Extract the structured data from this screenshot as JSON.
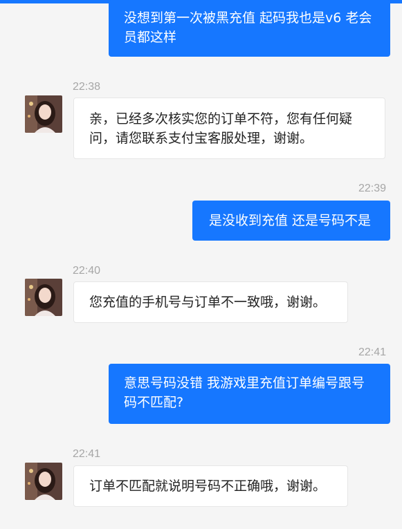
{
  "colors": {
    "accent": "#1677ff",
    "background": "#f5f5f5",
    "incoming_bubble": "#ffffff",
    "timestamp": "#a6a6a6"
  },
  "messages": [
    {
      "direction": "out",
      "time": "",
      "text": "没想到第一次被黑充值 起码我也是v6 老会员都这样"
    },
    {
      "direction": "in",
      "time": "22:38",
      "avatar_icon": "agent-avatar",
      "text": "亲，已经多次核实您的订单不符，您有任何疑问，请您联系支付宝客服处理，谢谢。"
    },
    {
      "direction": "out",
      "time": "22:39",
      "text": "是没收到充值 还是号码不是"
    },
    {
      "direction": "in",
      "time": "22:40",
      "avatar_icon": "agent-avatar",
      "text": "您充值的手机号与订单不一致哦，谢谢。"
    },
    {
      "direction": "out",
      "time": "22:41",
      "text": "意思号码没错 我游戏里充值订单编号跟号码不匹配?"
    },
    {
      "direction": "in",
      "time": "22:41",
      "avatar_icon": "agent-avatar",
      "text": "订单不匹配就说明号码不正确哦，谢谢。"
    }
  ]
}
